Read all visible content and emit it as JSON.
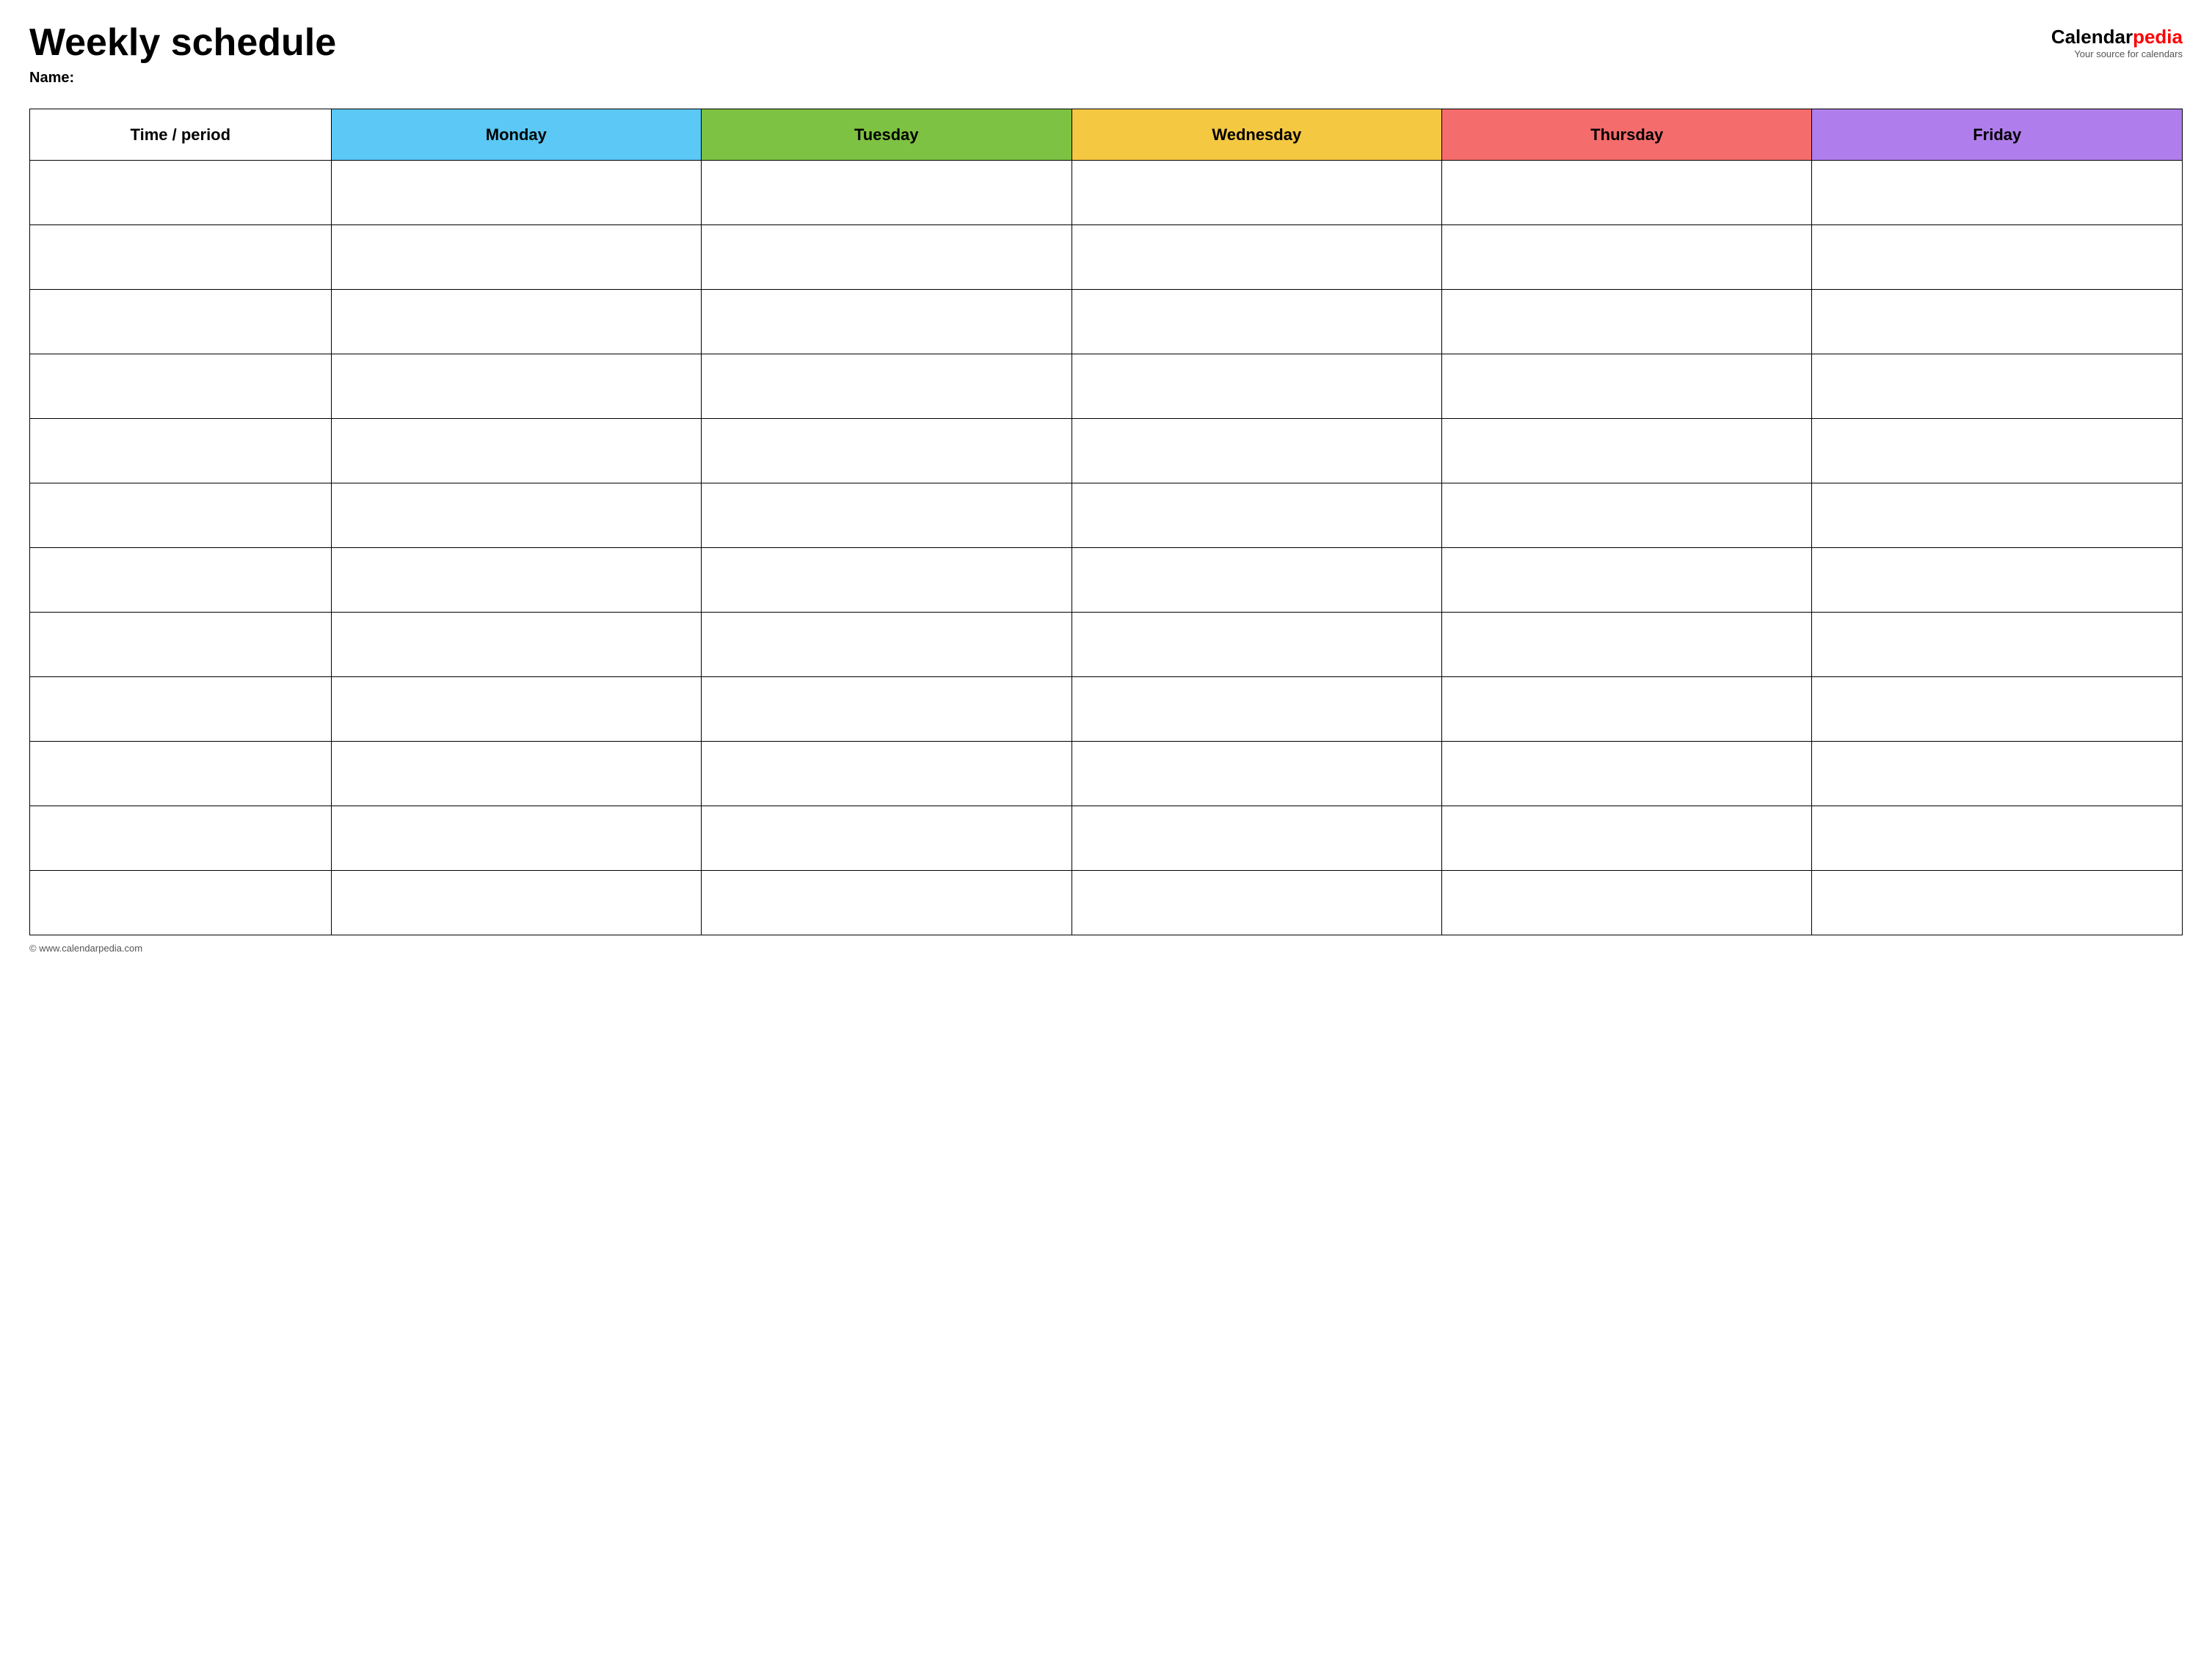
{
  "header": {
    "title": "Weekly schedule",
    "name_label": "Name:",
    "logo": {
      "calendar_text": "Calendar",
      "pedia_text": "pedia",
      "tagline": "Your source for calendars"
    }
  },
  "table": {
    "columns": [
      {
        "id": "time",
        "label": "Time / period",
        "color": "#ffffff"
      },
      {
        "id": "monday",
        "label": "Monday",
        "color": "#5bc8f5"
      },
      {
        "id": "tuesday",
        "label": "Tuesday",
        "color": "#7dc242"
      },
      {
        "id": "wednesday",
        "label": "Wednesday",
        "color": "#f5c842"
      },
      {
        "id": "thursday",
        "label": "Thursday",
        "color": "#f56c6c"
      },
      {
        "id": "friday",
        "label": "Friday",
        "color": "#b07eec"
      }
    ],
    "row_count": 12
  },
  "footer": {
    "copyright": "© www.calendarpedia.com"
  }
}
